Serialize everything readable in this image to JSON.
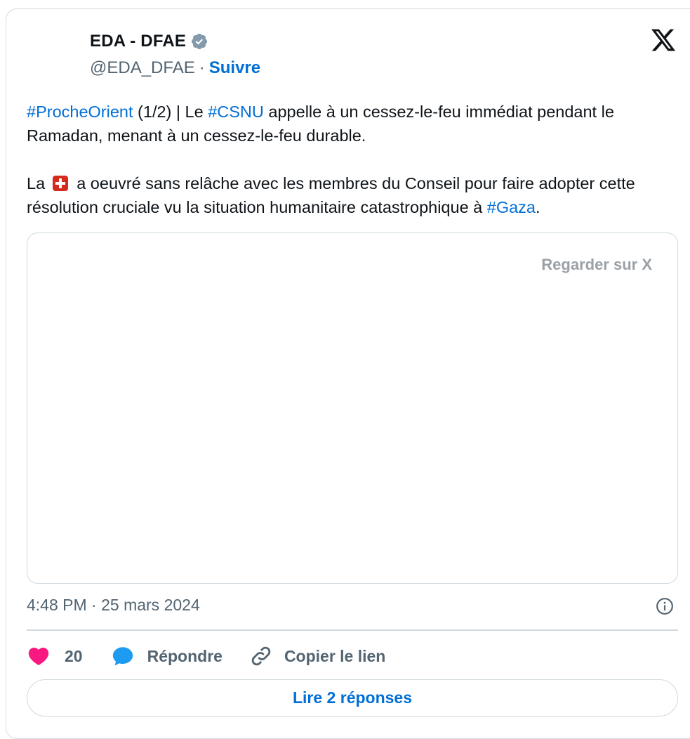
{
  "author": {
    "name": "EDA - DFAE",
    "handle": "@EDA_DFAE",
    "separator": "·",
    "follow_label": "Suivre",
    "verified_color": "#829aab"
  },
  "tweet": {
    "p1": {
      "tag1": "#ProcheOrient",
      "text1": " (1/2) | Le ",
      "tag2": "#CSNU",
      "text2": " appelle à un cessez-le-feu immédiat pendant le Ramadan, menant à un cessez-le-feu durable."
    },
    "p2": {
      "text1": "La",
      "flag_icon": "swiss-flag-emoji",
      "text2": "a oeuvré sans relâche avec les membres du Conseil pour faire adopter cette résolution cruciale vu la situation humanitaire catastrophique à ",
      "tag1": "#Gaza",
      "text3": "."
    }
  },
  "media": {
    "watch_label": "Regarder sur X"
  },
  "meta": {
    "timestamp": "4:48 PM · 25 mars 2024"
  },
  "actions": {
    "like_count": "20",
    "reply_label": "Répondre",
    "copy_label": "Copier le lien"
  },
  "read_replies_label": "Lire 2 réponses",
  "colors": {
    "link": "#006fd6",
    "like": "#f91880",
    "reply": "#1d9bf0",
    "muted": "#536471",
    "border": "#cfd9de"
  }
}
